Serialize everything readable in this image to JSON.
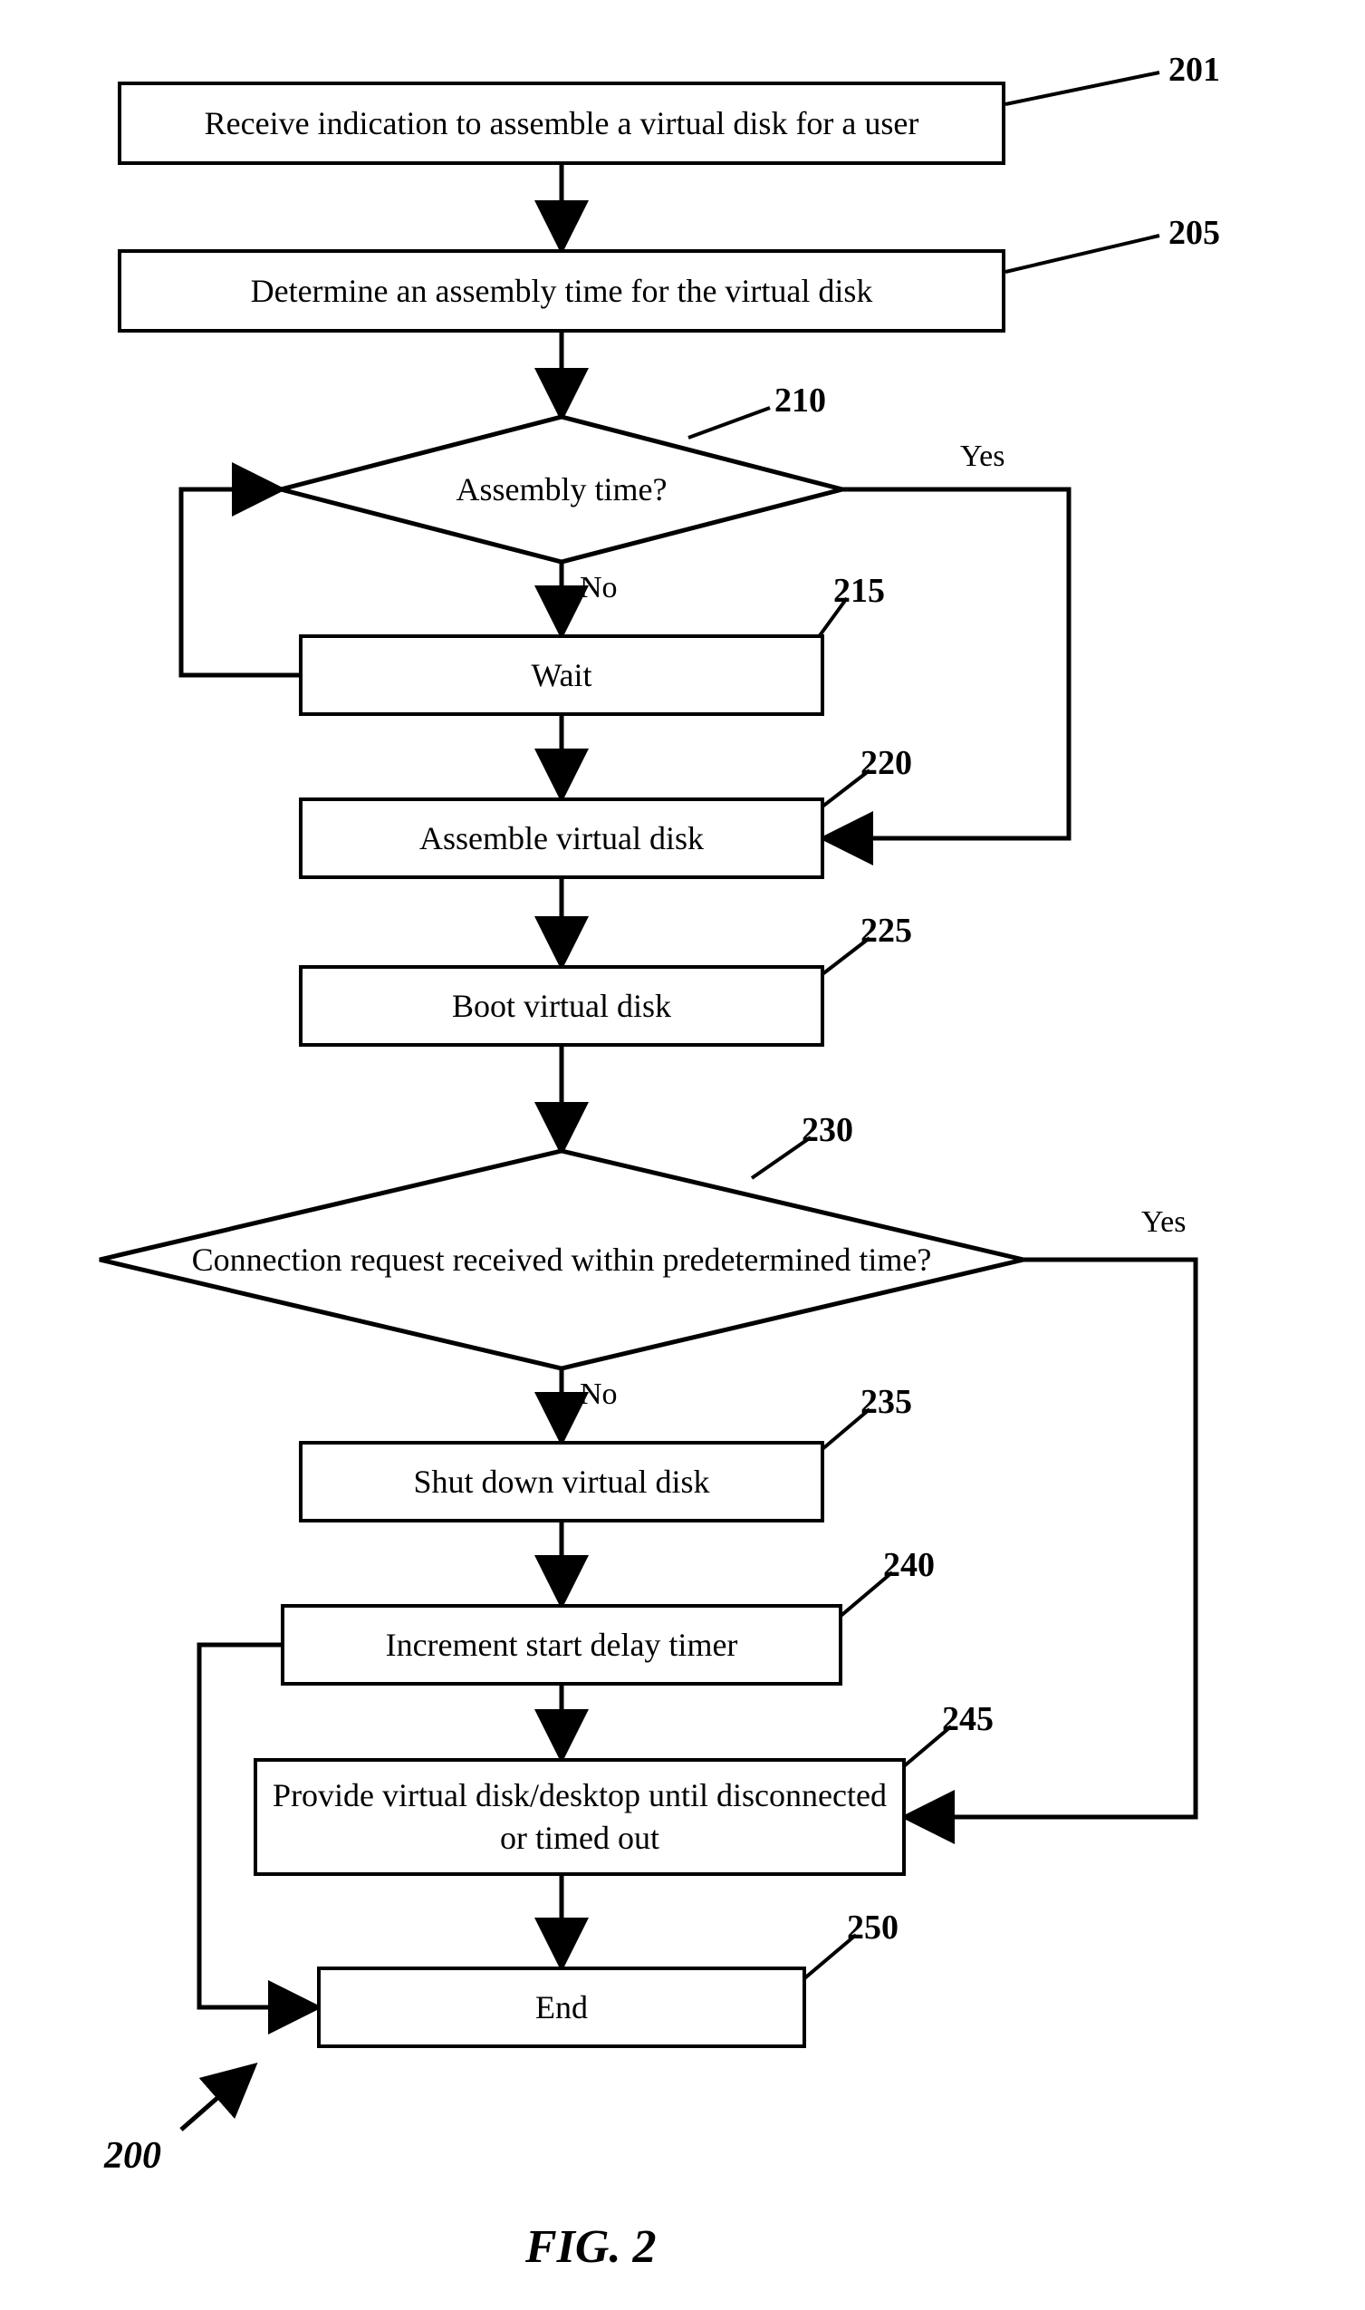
{
  "figure_caption": "FIG. 2",
  "flow_ref": "200",
  "nodes": {
    "n201": {
      "text": "Receive indication to assemble a virtual disk for a user",
      "ref": "201"
    },
    "n205": {
      "text": "Determine an assembly time for the virtual disk",
      "ref": "205"
    },
    "n210": {
      "text": "Assembly time?",
      "ref": "210",
      "yes": "Yes",
      "no": "No"
    },
    "n215": {
      "text": "Wait",
      "ref": "215"
    },
    "n220": {
      "text": "Assemble virtual disk",
      "ref": "220"
    },
    "n225": {
      "text": "Boot virtual disk",
      "ref": "225"
    },
    "n230": {
      "text": "Connection request received within predetermined time?",
      "ref": "230",
      "yes": "Yes",
      "no": "No"
    },
    "n235": {
      "text": "Shut down virtual disk",
      "ref": "235"
    },
    "n240": {
      "text": "Increment start delay timer",
      "ref": "240"
    },
    "n245": {
      "text": "Provide virtual disk/desktop until disconnected or timed out",
      "ref": "245"
    },
    "n250": {
      "text": "End",
      "ref": "250"
    }
  }
}
